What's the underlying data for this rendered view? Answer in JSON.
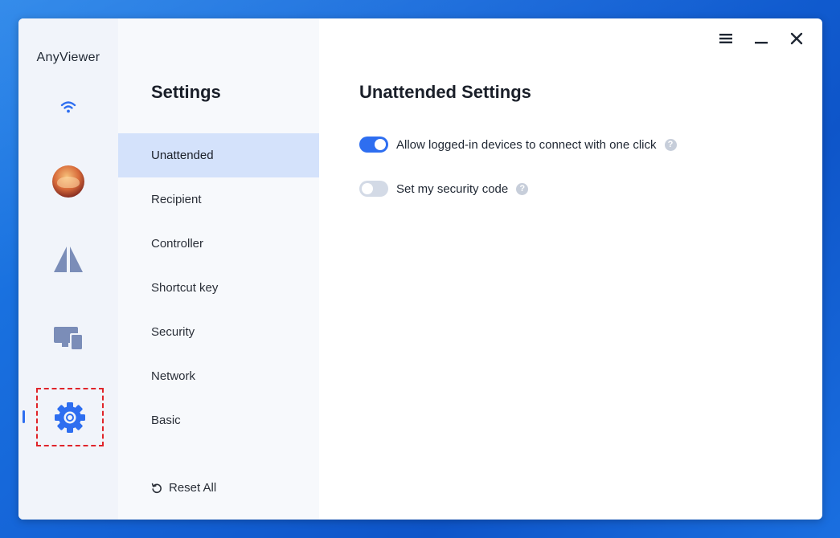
{
  "app": {
    "title": "AnyViewer"
  },
  "rail": {
    "items": [
      {
        "name": "connection",
        "icon": "wifi-icon"
      },
      {
        "name": "account",
        "icon": "avatar"
      },
      {
        "name": "remote-control",
        "icon": "remote-icon"
      },
      {
        "name": "devices",
        "icon": "devices-icon"
      },
      {
        "name": "settings",
        "icon": "gear-icon",
        "active": true
      }
    ]
  },
  "settings": {
    "title": "Settings",
    "menu": [
      {
        "label": "Unattended",
        "selected": true
      },
      {
        "label": "Recipient"
      },
      {
        "label": "Controller"
      },
      {
        "label": "Shortcut key"
      },
      {
        "label": "Security"
      },
      {
        "label": "Network"
      },
      {
        "label": "Basic"
      }
    ],
    "reset_label": "Reset All"
  },
  "content": {
    "title": "Unattended Settings",
    "options": [
      {
        "label": "Allow logged-in devices to connect with one click",
        "enabled": true
      },
      {
        "label": "Set my security code",
        "enabled": false
      }
    ],
    "help_glyph": "?"
  },
  "colors": {
    "accent": "#2e6ef0",
    "selected_bg": "#d4e2fb",
    "highlight_box": "#e0242a",
    "rail_icon": "#7b8db8"
  }
}
